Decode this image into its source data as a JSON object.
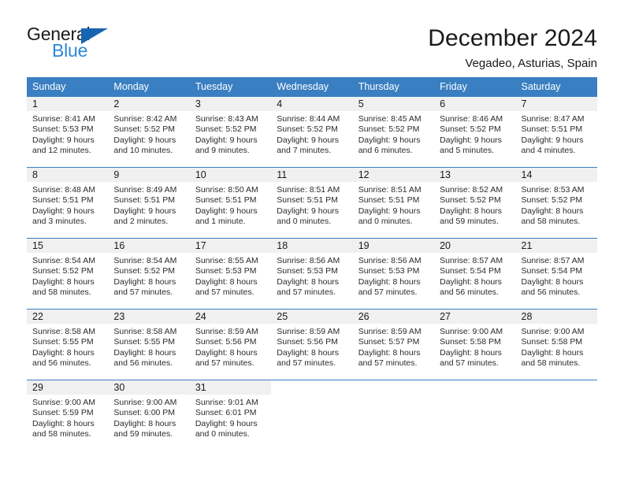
{
  "brand": {
    "name_top": "General",
    "name_bottom": "Blue",
    "triangle_color": "#1665b3",
    "blue_color": "#2e87d6"
  },
  "header": {
    "month_title": "December 2024",
    "location": "Vegadeo, Asturias, Spain"
  },
  "theme": {
    "header_bg": "#3a7fc1",
    "daynum_bg": "#f0f0f0",
    "grid_line": "#3a7fc1",
    "text": "#1a1a1a"
  },
  "weekday_headers": [
    "Sunday",
    "Monday",
    "Tuesday",
    "Wednesday",
    "Thursday",
    "Friday",
    "Saturday"
  ],
  "weeks": [
    [
      {
        "day": "1",
        "sunrise": "Sunrise: 8:41 AM",
        "sunset": "Sunset: 5:53 PM",
        "daylight_line1": "Daylight: 9 hours",
        "daylight_line2": "and 12 minutes."
      },
      {
        "day": "2",
        "sunrise": "Sunrise: 8:42 AM",
        "sunset": "Sunset: 5:52 PM",
        "daylight_line1": "Daylight: 9 hours",
        "daylight_line2": "and 10 minutes."
      },
      {
        "day": "3",
        "sunrise": "Sunrise: 8:43 AM",
        "sunset": "Sunset: 5:52 PM",
        "daylight_line1": "Daylight: 9 hours",
        "daylight_line2": "and 9 minutes."
      },
      {
        "day": "4",
        "sunrise": "Sunrise: 8:44 AM",
        "sunset": "Sunset: 5:52 PM",
        "daylight_line1": "Daylight: 9 hours",
        "daylight_line2": "and 7 minutes."
      },
      {
        "day": "5",
        "sunrise": "Sunrise: 8:45 AM",
        "sunset": "Sunset: 5:52 PM",
        "daylight_line1": "Daylight: 9 hours",
        "daylight_line2": "and 6 minutes."
      },
      {
        "day": "6",
        "sunrise": "Sunrise: 8:46 AM",
        "sunset": "Sunset: 5:52 PM",
        "daylight_line1": "Daylight: 9 hours",
        "daylight_line2": "and 5 minutes."
      },
      {
        "day": "7",
        "sunrise": "Sunrise: 8:47 AM",
        "sunset": "Sunset: 5:51 PM",
        "daylight_line1": "Daylight: 9 hours",
        "daylight_line2": "and 4 minutes."
      }
    ],
    [
      {
        "day": "8",
        "sunrise": "Sunrise: 8:48 AM",
        "sunset": "Sunset: 5:51 PM",
        "daylight_line1": "Daylight: 9 hours",
        "daylight_line2": "and 3 minutes."
      },
      {
        "day": "9",
        "sunrise": "Sunrise: 8:49 AM",
        "sunset": "Sunset: 5:51 PM",
        "daylight_line1": "Daylight: 9 hours",
        "daylight_line2": "and 2 minutes."
      },
      {
        "day": "10",
        "sunrise": "Sunrise: 8:50 AM",
        "sunset": "Sunset: 5:51 PM",
        "daylight_line1": "Daylight: 9 hours",
        "daylight_line2": "and 1 minute."
      },
      {
        "day": "11",
        "sunrise": "Sunrise: 8:51 AM",
        "sunset": "Sunset: 5:51 PM",
        "daylight_line1": "Daylight: 9 hours",
        "daylight_line2": "and 0 minutes."
      },
      {
        "day": "12",
        "sunrise": "Sunrise: 8:51 AM",
        "sunset": "Sunset: 5:51 PM",
        "daylight_line1": "Daylight: 9 hours",
        "daylight_line2": "and 0 minutes."
      },
      {
        "day": "13",
        "sunrise": "Sunrise: 8:52 AM",
        "sunset": "Sunset: 5:52 PM",
        "daylight_line1": "Daylight: 8 hours",
        "daylight_line2": "and 59 minutes."
      },
      {
        "day": "14",
        "sunrise": "Sunrise: 8:53 AM",
        "sunset": "Sunset: 5:52 PM",
        "daylight_line1": "Daylight: 8 hours",
        "daylight_line2": "and 58 minutes."
      }
    ],
    [
      {
        "day": "15",
        "sunrise": "Sunrise: 8:54 AM",
        "sunset": "Sunset: 5:52 PM",
        "daylight_line1": "Daylight: 8 hours",
        "daylight_line2": "and 58 minutes."
      },
      {
        "day": "16",
        "sunrise": "Sunrise: 8:54 AM",
        "sunset": "Sunset: 5:52 PM",
        "daylight_line1": "Daylight: 8 hours",
        "daylight_line2": "and 57 minutes."
      },
      {
        "day": "17",
        "sunrise": "Sunrise: 8:55 AM",
        "sunset": "Sunset: 5:53 PM",
        "daylight_line1": "Daylight: 8 hours",
        "daylight_line2": "and 57 minutes."
      },
      {
        "day": "18",
        "sunrise": "Sunrise: 8:56 AM",
        "sunset": "Sunset: 5:53 PM",
        "daylight_line1": "Daylight: 8 hours",
        "daylight_line2": "and 57 minutes."
      },
      {
        "day": "19",
        "sunrise": "Sunrise: 8:56 AM",
        "sunset": "Sunset: 5:53 PM",
        "daylight_line1": "Daylight: 8 hours",
        "daylight_line2": "and 57 minutes."
      },
      {
        "day": "20",
        "sunrise": "Sunrise: 8:57 AM",
        "sunset": "Sunset: 5:54 PM",
        "daylight_line1": "Daylight: 8 hours",
        "daylight_line2": "and 56 minutes."
      },
      {
        "day": "21",
        "sunrise": "Sunrise: 8:57 AM",
        "sunset": "Sunset: 5:54 PM",
        "daylight_line1": "Daylight: 8 hours",
        "daylight_line2": "and 56 minutes."
      }
    ],
    [
      {
        "day": "22",
        "sunrise": "Sunrise: 8:58 AM",
        "sunset": "Sunset: 5:55 PM",
        "daylight_line1": "Daylight: 8 hours",
        "daylight_line2": "and 56 minutes."
      },
      {
        "day": "23",
        "sunrise": "Sunrise: 8:58 AM",
        "sunset": "Sunset: 5:55 PM",
        "daylight_line1": "Daylight: 8 hours",
        "daylight_line2": "and 56 minutes."
      },
      {
        "day": "24",
        "sunrise": "Sunrise: 8:59 AM",
        "sunset": "Sunset: 5:56 PM",
        "daylight_line1": "Daylight: 8 hours",
        "daylight_line2": "and 57 minutes."
      },
      {
        "day": "25",
        "sunrise": "Sunrise: 8:59 AM",
        "sunset": "Sunset: 5:56 PM",
        "daylight_line1": "Daylight: 8 hours",
        "daylight_line2": "and 57 minutes."
      },
      {
        "day": "26",
        "sunrise": "Sunrise: 8:59 AM",
        "sunset": "Sunset: 5:57 PM",
        "daylight_line1": "Daylight: 8 hours",
        "daylight_line2": "and 57 minutes."
      },
      {
        "day": "27",
        "sunrise": "Sunrise: 9:00 AM",
        "sunset": "Sunset: 5:58 PM",
        "daylight_line1": "Daylight: 8 hours",
        "daylight_line2": "and 57 minutes."
      },
      {
        "day": "28",
        "sunrise": "Sunrise: 9:00 AM",
        "sunset": "Sunset: 5:58 PM",
        "daylight_line1": "Daylight: 8 hours",
        "daylight_line2": "and 58 minutes."
      }
    ],
    [
      {
        "day": "29",
        "sunrise": "Sunrise: 9:00 AM",
        "sunset": "Sunset: 5:59 PM",
        "daylight_line1": "Daylight: 8 hours",
        "daylight_line2": "and 58 minutes."
      },
      {
        "day": "30",
        "sunrise": "Sunrise: 9:00 AM",
        "sunset": "Sunset: 6:00 PM",
        "daylight_line1": "Daylight: 8 hours",
        "daylight_line2": "and 59 minutes."
      },
      {
        "day": "31",
        "sunrise": "Sunrise: 9:01 AM",
        "sunset": "Sunset: 6:01 PM",
        "daylight_line1": "Daylight: 9 hours",
        "daylight_line2": "and 0 minutes."
      },
      null,
      null,
      null,
      null
    ]
  ]
}
